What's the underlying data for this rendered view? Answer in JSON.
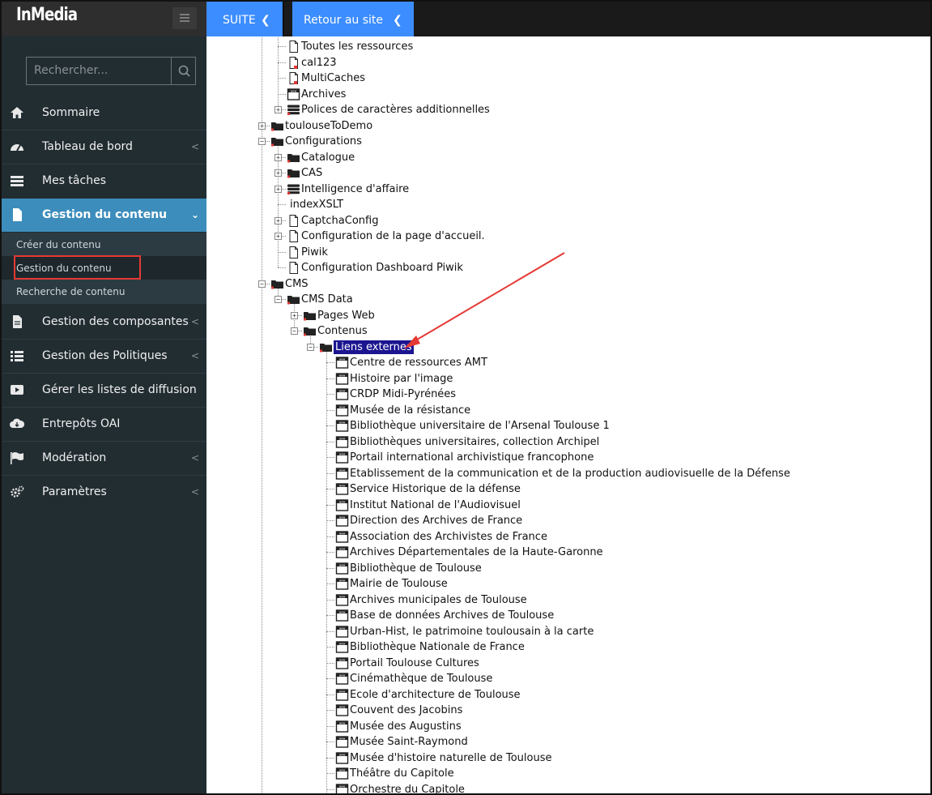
{
  "brand": {
    "name": "InMedia"
  },
  "search": {
    "placeholder": "Rechercher..."
  },
  "sidebar": {
    "items": [
      {
        "label": "Sommaire",
        "icon": "home-icon",
        "chevron": false
      },
      {
        "label": "Tableau de bord",
        "icon": "dashboard-icon",
        "chevron": true
      },
      {
        "label": "Mes tâches",
        "icon": "tasks-icon",
        "chevron": false
      },
      {
        "label": "Gestion du contenu",
        "icon": "file-icon",
        "chevron": true,
        "active": true
      },
      {
        "label": "Gestion des composantes",
        "icon": "document-icon",
        "chevron": true
      },
      {
        "label": "Gestion des Politiques",
        "icon": "list-icon",
        "chevron": true
      },
      {
        "label": "Gérer les listes de diffusion",
        "icon": "play-icon",
        "chevron": false
      },
      {
        "label": "Entrepôts OAI",
        "icon": "cloud-download-icon",
        "chevron": false
      },
      {
        "label": "Modération",
        "icon": "flag-icon",
        "chevron": true
      },
      {
        "label": "Paramètres",
        "icon": "cogs-icon",
        "chevron": true
      }
    ],
    "submenu": [
      "Créer du contenu",
      "Gestion du contenu",
      "Recherche de contenu"
    ]
  },
  "topbar": {
    "suite_label": "SUITE",
    "retour_label": "Retour au site",
    "chevron": "❮"
  },
  "tree": {
    "nodes": [
      {
        "label": "Toutes les ressources",
        "icon": "page-icon",
        "level": 2
      },
      {
        "label": "cal123",
        "icon": "page-red-icon",
        "level": 2
      },
      {
        "label": "MultiCaches",
        "icon": "page-red-icon",
        "level": 2
      },
      {
        "label": "Archives",
        "icon": "www-icon",
        "level": 2
      },
      {
        "label": "Polices de caractères additionnelles",
        "icon": "database-icon",
        "level": 2,
        "expander": "+"
      },
      {
        "label": "toulouseToDemo",
        "icon": "folder-icon",
        "level": 1,
        "expander": "+"
      },
      {
        "label": "Configurations",
        "icon": "folder-icon",
        "level": 1,
        "expander": "-"
      },
      {
        "label": "Catalogue",
        "icon": "folder-icon",
        "level": 2,
        "expander": "+"
      },
      {
        "label": "CAS",
        "icon": "folder-icon",
        "level": 2,
        "expander": "+"
      },
      {
        "label": "Intelligence d'affaire",
        "icon": "database-icon",
        "level": 2,
        "expander": "+"
      },
      {
        "label": "indexXSLT",
        "icon": "none",
        "level": 2
      },
      {
        "label": "CaptchaConfig",
        "icon": "page-icon",
        "level": 2,
        "expander": "+"
      },
      {
        "label": "Configuration de la page d'accueil.",
        "icon": "page-icon",
        "level": 2,
        "expander": "+"
      },
      {
        "label": "Piwik",
        "icon": "page-icon",
        "level": 2
      },
      {
        "label": "Configuration Dashboard Piwik",
        "icon": "page-icon",
        "level": 2
      },
      {
        "label": "CMS",
        "icon": "folder-icon",
        "level": 1,
        "expander": "-"
      },
      {
        "label": "CMS Data",
        "icon": "folder-icon",
        "level": 2,
        "expander": "-"
      },
      {
        "label": "Pages Web",
        "icon": "folder-icon",
        "level": 3,
        "expander": "+"
      },
      {
        "label": "Contenus",
        "icon": "folder-icon",
        "level": 3,
        "expander": "-"
      },
      {
        "label": "Liens externes",
        "icon": "folder-icon",
        "level": 4,
        "expander": "-",
        "selected": true
      },
      {
        "label": "Centre de ressources AMT",
        "icon": "www-icon",
        "level": 5
      },
      {
        "label": "Histoire par l'image",
        "icon": "www-icon",
        "level": 5
      },
      {
        "label": "CRDP Midi-Pyrénées",
        "icon": "www-icon",
        "level": 5
      },
      {
        "label": "Musée de la résistance",
        "icon": "www-icon",
        "level": 5
      },
      {
        "label": "Bibliothèque universitaire de l'Arsenal Toulouse 1",
        "icon": "www-icon",
        "level": 5
      },
      {
        "label": "Bibliothèques universitaires, collection Archipel",
        "icon": "www-icon",
        "level": 5
      },
      {
        "label": "Portail international archivistique francophone",
        "icon": "www-icon",
        "level": 5
      },
      {
        "label": "Etablissement de la communication et de la production audiovisuelle de la Défense",
        "icon": "www-icon",
        "level": 5
      },
      {
        "label": "Service Historique de la défense",
        "icon": "www-icon",
        "level": 5
      },
      {
        "label": "Institut National de l'Audiovisuel",
        "icon": "www-icon",
        "level": 5
      },
      {
        "label": "Direction des Archives de France",
        "icon": "www-icon",
        "level": 5
      },
      {
        "label": "Association des Archivistes de France",
        "icon": "www-icon",
        "level": 5
      },
      {
        "label": "Archives Départementales de la Haute-Garonne",
        "icon": "www-icon",
        "level": 5
      },
      {
        "label": "Bibliothèque de Toulouse",
        "icon": "www-icon",
        "level": 5
      },
      {
        "label": "Mairie de Toulouse",
        "icon": "www-icon",
        "level": 5
      },
      {
        "label": "Archives municipales de Toulouse",
        "icon": "www-icon",
        "level": 5
      },
      {
        "label": "Base de données Archives de Toulouse",
        "icon": "www-icon",
        "level": 5
      },
      {
        "label": "Urban-Hist, le patrimoine toulousain à la carte",
        "icon": "www-icon",
        "level": 5
      },
      {
        "label": "Bibliothèque Nationale de France",
        "icon": "www-icon",
        "level": 5
      },
      {
        "label": "Portail Toulouse Cultures",
        "icon": "www-icon",
        "level": 5
      },
      {
        "label": "Cinémathèque de Toulouse",
        "icon": "www-icon",
        "level": 5
      },
      {
        "label": "Ecole d'architecture de Toulouse",
        "icon": "www-icon",
        "level": 5
      },
      {
        "label": "Couvent des Jacobins",
        "icon": "www-icon",
        "level": 5
      },
      {
        "label": "Musée des Augustins",
        "icon": "www-icon",
        "level": 5
      },
      {
        "label": "Musée Saint-Raymond",
        "icon": "www-icon",
        "level": 5
      },
      {
        "label": "Musée d'histoire naturelle de Toulouse",
        "icon": "www-icon",
        "level": 5
      },
      {
        "label": "Théâtre du Capitole",
        "icon": "www-icon",
        "level": 5
      },
      {
        "label": "Orchestre du Capitole",
        "icon": "www-icon",
        "level": 5
      }
    ]
  },
  "colors": {
    "sidebar_bg": "#222d32",
    "accent": "#3c8dbc",
    "topbar_button": "#3c8dff",
    "selection": "#1b1590",
    "annotation_red": "#e53935"
  }
}
